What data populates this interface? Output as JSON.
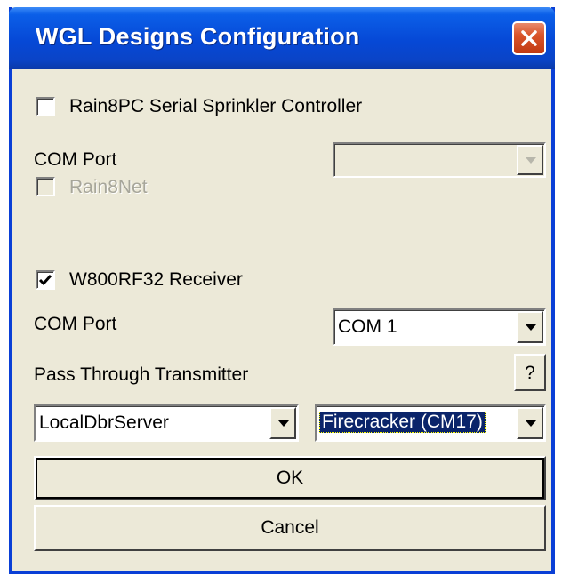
{
  "window": {
    "title": "WGL Designs Configuration"
  },
  "rain8": {
    "checkbox_label": "Rain8PC Serial Sprinkler Controller",
    "checked": false,
    "com_port_label": "COM Port",
    "com_port_value": "",
    "rain8net_label": "Rain8Net",
    "rain8net_checked": false
  },
  "w800": {
    "checkbox_label": "W800RF32 Receiver",
    "checked": true,
    "com_port_label": "COM Port",
    "com_port_value": "COM 1",
    "pass_through_label": "Pass Through Transmitter",
    "help_label": "?",
    "server_value": "LocalDbrServer",
    "transmitter_value": "Firecracker (CM17)"
  },
  "buttons": {
    "ok": "OK",
    "cancel": "Cancel"
  },
  "icons": {
    "close": "close-icon",
    "check": "check-icon",
    "dropdown": "chevron-down-icon"
  },
  "colors": {
    "titlebar": "#0648d6",
    "close": "#d9542a",
    "face": "#ece9d8",
    "selection": "#0a246a"
  }
}
